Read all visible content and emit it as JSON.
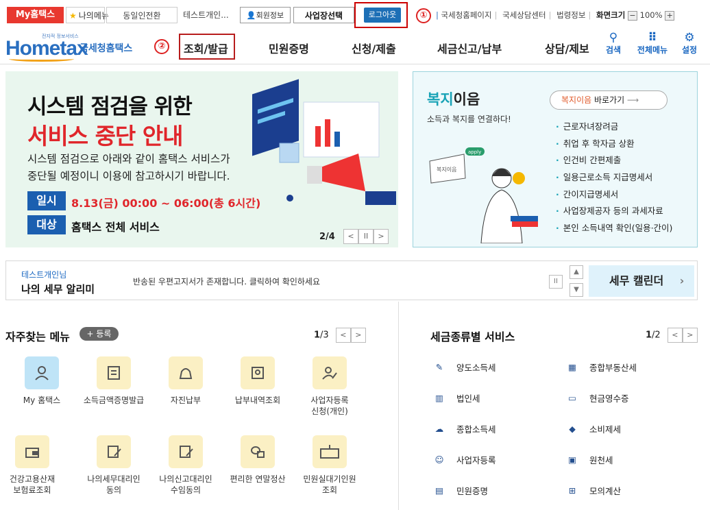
{
  "topbar": {
    "my_hometax": "My홈택스",
    "my_menu": "나의메뉴",
    "cross_switch": "동일인전환",
    "user_name": "테스트개인...",
    "member_info": "회원정보",
    "business_select": "사업장선택",
    "logout": "로그아웃",
    "marker1": "①",
    "links": [
      "국세청홈페이지",
      "국세상담센터",
      "법령정보"
    ],
    "link_prefix": "|",
    "screen_size_label": "화면크기",
    "zoom_minus": "−",
    "zoom_value": "100%",
    "zoom_plus": "+"
  },
  "nav": {
    "logo_small": "전자적 정보서비스",
    "logo_main": "Hometax",
    "logo_kr": "국세청홈택스",
    "marker2": "②",
    "items": [
      "조회/발급",
      "민원증명",
      "신청/제출",
      "세금신고/납부",
      "상담/제보"
    ],
    "tools": [
      {
        "icon": "search-icon",
        "label": "검색"
      },
      {
        "icon": "grid-icon",
        "label": "전체메뉴"
      },
      {
        "icon": "gear-icon",
        "label": "설정"
      }
    ]
  },
  "banner": {
    "headline1": "시스템 점검을 위한",
    "headline2": "서비스 중단 안내",
    "desc1": "시스템 점검으로 아래와 같이 홈택스 서비스가",
    "desc2": "중단될 예정이니 이용에 참고하시기 바랍니다.",
    "tag_date": "일시",
    "date_value": "8.13(금) 00:00 ~ 06:00(총 6시간)",
    "tag_target": "대상",
    "target_value": "홈택스 전체 서비스",
    "page_indicator": "2/4",
    "prev": "<",
    "pause": "II",
    "next": ">"
  },
  "welfare": {
    "title_hl": "복지",
    "title_rest": "이음",
    "subtitle": "소득과 복지를 연결하다!",
    "goto_hl": "복지이음",
    "goto_rest": " 바로가기",
    "goto_arrow": "⟶",
    "items": [
      "근로자녀장려금",
      "취업 후 학자금 상환",
      "인건비 간편제출",
      "일용근로소득 지급명세서",
      "간이지급명세서",
      "사업장제공자 등의 과세자료",
      "본인 소득내역 확인(일용·간이)"
    ],
    "sign_text": "복지이음",
    "bubble_text": "apply"
  },
  "notice": {
    "who": "테스트개인님",
    "title": "나의 세무 알리미",
    "message": "반송된 우편고지서가 존재합니다. 클릭하여 확인하세요",
    "pause": "II",
    "up": "▲",
    "down": "▼",
    "calendar": "세무 캘린더",
    "calendar_arrow": "›"
  },
  "favorites": {
    "title": "자주찾는 메뉴",
    "register": "+ 등록",
    "page_current": "1",
    "page_total": "/3",
    "prev": "<",
    "next": ">",
    "items": [
      {
        "label": "My 홈택스",
        "icon": "person-icon"
      },
      {
        "label": "소득금액증명발급",
        "icon": "document-icon"
      },
      {
        "label": "자진납부",
        "icon": "money-bag-icon"
      },
      {
        "label": "납부내역조회",
        "icon": "receipt-icon"
      },
      {
        "label": "사업자등록\n신청(개인)",
        "icon": "person-edit-icon"
      },
      {
        "label": "건강고용산재\n보험료조회",
        "icon": "wallet-icon"
      },
      {
        "label": "나의세무대리인\n동의",
        "icon": "sign-icon"
      },
      {
        "label": "나의신고대리인\n수임동의",
        "icon": "sign-icon"
      },
      {
        "label": "편리한 연말정산",
        "icon": "coins-icon"
      },
      {
        "label": "민원실대기인원\n조회",
        "icon": "queue-display-icon"
      }
    ]
  },
  "tax_services": {
    "title": "세금종류별 서비스",
    "page_current": "1",
    "page_total": "/2",
    "prev": "<",
    "next": ">",
    "items": [
      {
        "label": "양도소득세",
        "icon": "transfer-icon"
      },
      {
        "label": "종합부동산세",
        "icon": "building-icon"
      },
      {
        "label": "법인세",
        "icon": "office-icon"
      },
      {
        "label": "현금영수증",
        "icon": "cash-receipt-icon"
      },
      {
        "label": "종합소득세",
        "icon": "income-icon"
      },
      {
        "label": "소비제세",
        "icon": "diamond-icon"
      },
      {
        "label": "사업자등록",
        "icon": "person-icon"
      },
      {
        "label": "원천세",
        "icon": "withholding-icon"
      },
      {
        "label": "민원증명",
        "icon": "certificate-icon"
      },
      {
        "label": "모의계산",
        "icon": "calculator-icon"
      }
    ]
  },
  "colors": {
    "accent_red": "#e0262b",
    "brand_blue": "#1a67c1",
    "teal": "#19a3b6"
  }
}
